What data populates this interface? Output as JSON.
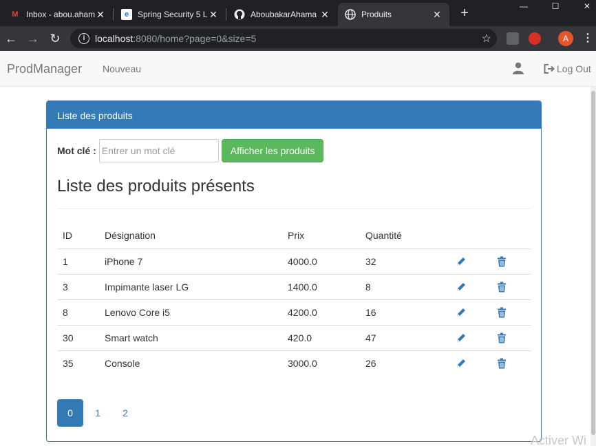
{
  "browser": {
    "tabs": [
      {
        "title": "Inbox - abou.aham",
        "favicon": "gmail-icon",
        "active": false
      },
      {
        "title": "Spring Security 5 L",
        "favicon": "page-icon",
        "active": false
      },
      {
        "title": "AboubakarAhama",
        "favicon": "github-icon",
        "active": false
      },
      {
        "title": "Produits",
        "favicon": "globe-icon",
        "active": true
      }
    ],
    "url_host": "localhost",
    "url_rest": ":8080/home?page=0&size=5",
    "avatar_letter": "A"
  },
  "navbar": {
    "brand": "ProdManager",
    "nouveau": "Nouveau",
    "logout": "Log Out"
  },
  "panel": {
    "heading": "Liste des produits",
    "search_label": "Mot clé :",
    "search_placeholder": "Entrer un mot clé",
    "search_button": "Afficher les produits",
    "list_title": "Liste des produits présents"
  },
  "table": {
    "headers": {
      "id": "ID",
      "designation": "Désignation",
      "prix": "Prix",
      "quantite": "Quantité"
    },
    "rows": [
      {
        "id": "1",
        "designation": "iPhone 7",
        "prix": "4000.0",
        "quantite": "32"
      },
      {
        "id": "3",
        "designation": "Impimante laser LG",
        "prix": "1400.0",
        "quantite": "8"
      },
      {
        "id": "8",
        "designation": "Lenovo Core i5",
        "prix": "4200.0",
        "quantite": "16"
      },
      {
        "id": "30",
        "designation": "Smart watch",
        "prix": "420.0",
        "quantite": "47"
      },
      {
        "id": "35",
        "designation": "Console",
        "prix": "3000.0",
        "quantite": "26"
      }
    ]
  },
  "pagination": {
    "pages": [
      "0",
      "1",
      "2"
    ],
    "active": "0"
  },
  "watermark": "Activer Wi",
  "colors": {
    "primary": "#337ab7",
    "success": "#5cb85c"
  }
}
